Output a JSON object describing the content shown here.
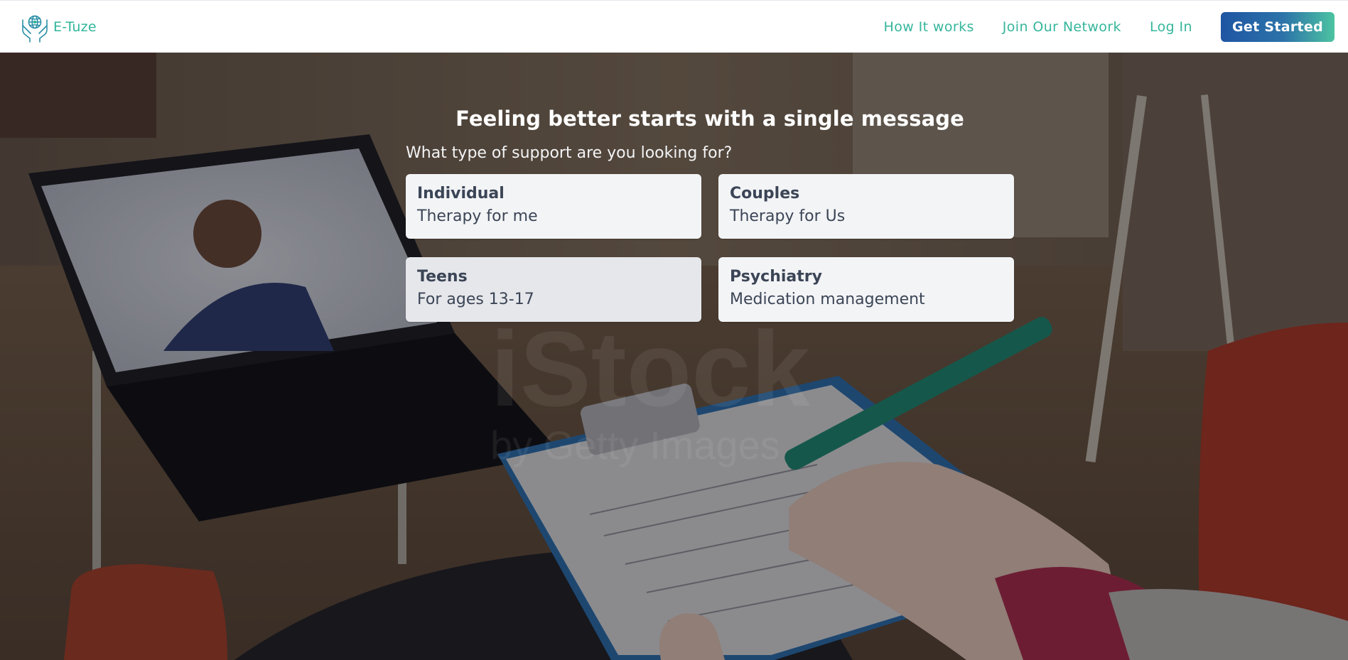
{
  "brand": {
    "name": "E-Tuze",
    "logo_icon": "hands-holding-globe-icon",
    "color": "#2fb59a"
  },
  "nav": {
    "links": [
      {
        "label": "How It works"
      },
      {
        "label": "Join Our Network"
      },
      {
        "label": "Log In"
      }
    ],
    "cta_label": "Get Started"
  },
  "hero": {
    "title": "Feeling better starts with a single message",
    "question": "What type of support are you looking for?",
    "options": [
      {
        "title": "Individual",
        "description": "Therapy for me"
      },
      {
        "title": "Couples",
        "description": "Therapy for Us"
      },
      {
        "title": "Teens",
        "description": "For ages 13-17"
      },
      {
        "title": "Psychiatry",
        "description": "Medication management"
      }
    ],
    "background_image": "therapist-taking-notes-during-video-session-photo",
    "watermark": "iStock",
    "watermark_sub": "by Getty Images"
  },
  "colors": {
    "accent": "#35b69b",
    "cta_start": "#1f55a3",
    "cta_end": "#4dc3a2",
    "card_bg": "#f3f4f6",
    "card_text": "#3b4556"
  }
}
